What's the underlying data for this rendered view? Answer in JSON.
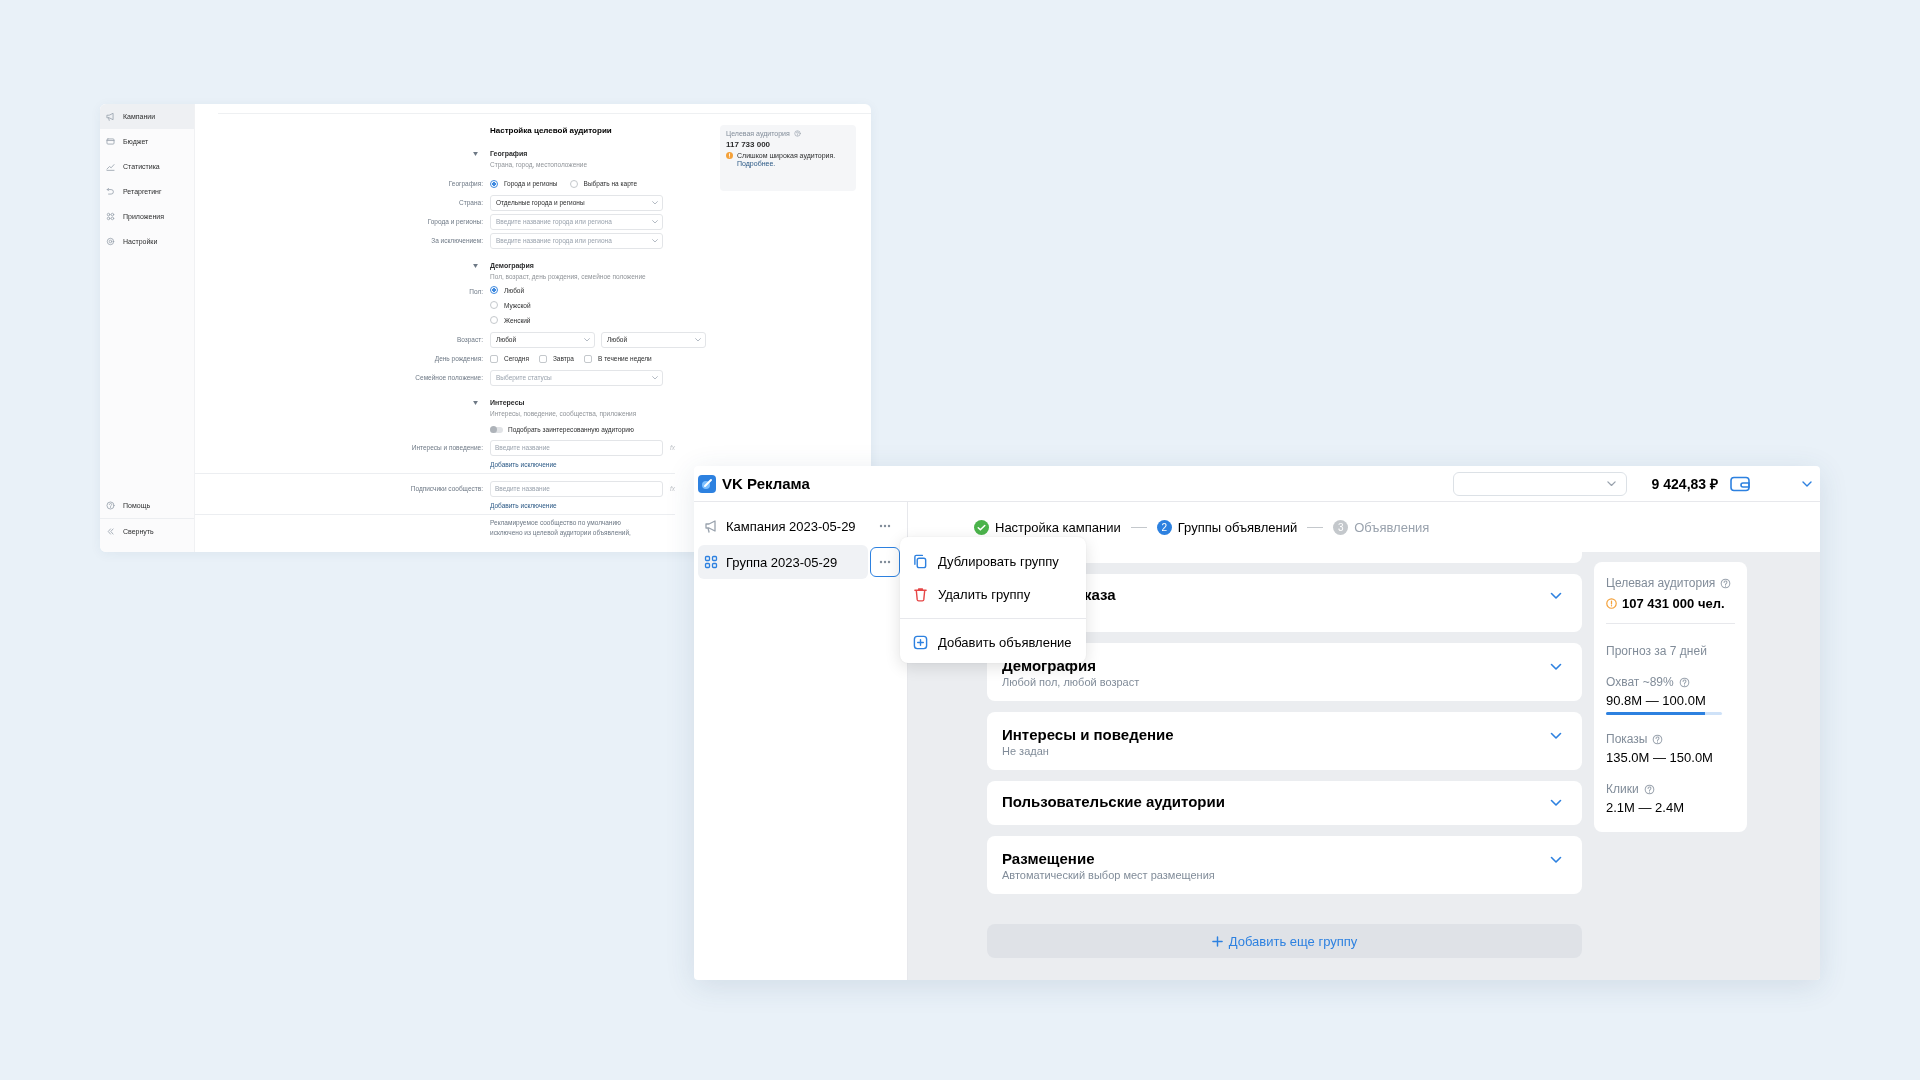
{
  "back_window": {
    "sidebar": {
      "items": [
        {
          "label": "Кампании",
          "selected": true
        },
        {
          "label": "Бюджет",
          "selected": false
        },
        {
          "label": "Статистика",
          "selected": false
        },
        {
          "label": "Ретаргетинг",
          "selected": false
        },
        {
          "label": "Приложения",
          "selected": false
        },
        {
          "label": "Настройки",
          "selected": false
        }
      ],
      "footer": [
        {
          "label": "Помощь"
        },
        {
          "label": "Свернуть"
        }
      ]
    },
    "form": {
      "title": "Настройка целевой аудитории",
      "sections": [
        {
          "title": "География",
          "subtitle": "Страна, город, местоположение",
          "rows": [
            {
              "kind": "radio-inline",
              "label": "География:",
              "options": [
                {
                  "label": "Города и регионы",
                  "selected": true
                },
                {
                  "label": "Выбрать на карте",
                  "selected": false
                }
              ]
            },
            {
              "kind": "select",
              "label": "Страна:",
              "value": "Отдельные города и регионы"
            },
            {
              "kind": "select",
              "label": "Города и регионы:",
              "placeholder": "Введите название города или региона"
            },
            {
              "kind": "select",
              "label": "За исключением:",
              "placeholder": "Введите название города или региона"
            }
          ]
        },
        {
          "title": "Демография",
          "subtitle": "Пол, возраст, день рождения, семейное положение",
          "rows": [
            {
              "kind": "radio-stack",
              "label": "Пол:",
              "options": [
                {
                  "label": "Любой",
                  "selected": true
                },
                {
                  "label": "Мужской",
                  "selected": false
                },
                {
                  "label": "Женский",
                  "selected": false
                }
              ]
            },
            {
              "kind": "select-pair",
              "label": "Возраст:",
              "values": [
                "Любой",
                "Любой"
              ]
            },
            {
              "kind": "checkboxes",
              "label": "День рождения:",
              "options": [
                {
                  "label": "Сегодня",
                  "checked": false
                },
                {
                  "label": "Завтра",
                  "checked": false
                },
                {
                  "label": "В течение недели",
                  "checked": false
                }
              ]
            },
            {
              "kind": "select",
              "label": "Семейное положение:",
              "placeholder": "Выберите статусы"
            }
          ]
        },
        {
          "title": "Интересы",
          "subtitle": "Интересы, поведение, сообщества, приложения",
          "rows": [
            {
              "kind": "toggle",
              "text": "Подобрать заинтересованную аудиторию",
              "on": false
            },
            {
              "kind": "input",
              "label": "Интересы и поведение:",
              "placeholder": "Введите название",
              "suffix": "fx",
              "link": "Добавить исключение"
            },
            {
              "kind": "input",
              "label": "Подписчики сообществ:",
              "placeholder": "Введите название",
              "suffix": "fx",
              "link": "Добавить исключение"
            },
            {
              "kind": "note",
              "text": "Рекламируемое сообщество по умолчанию исключено из целевой аудитории объявлений,"
            }
          ]
        }
      ]
    },
    "aside": {
      "label": "Целевая аудитория",
      "value": "117 733 000",
      "warning": "Слишком широкая аудитория.",
      "link": "Подробнее."
    }
  },
  "front_window": {
    "header": {
      "title": "VK Реклама",
      "balance": "9 424,83 ₽"
    },
    "tree": [
      {
        "label": "Кампания 2023-05-29",
        "kind": "campaign",
        "selected": false,
        "menu_open": false
      },
      {
        "label": "Группа 2023-05-29",
        "kind": "group",
        "selected": true,
        "menu_open": true
      }
    ],
    "menu": [
      {
        "label": "Дублировать группу",
        "kind": "copy",
        "divider_before": false
      },
      {
        "label": "Удалить группу",
        "kind": "delete",
        "divider_before": false
      },
      {
        "label": "Добавить объявление",
        "kind": "add",
        "divider_before": true
      }
    ],
    "steps": [
      {
        "label": "Настройка кампании",
        "completed": true,
        "selected": false
      },
      {
        "number": "2",
        "label": "Группы объявлений",
        "completed": false,
        "selected": true
      },
      {
        "number": "3",
        "label": "Объявления",
        "completed": false,
        "selected": false
      }
    ],
    "cards": [
      {
        "kind": "covered",
        "title": "каза"
      },
      {
        "kind": "section",
        "title": "Демография",
        "subtitle": "Любой пол, любой возраст"
      },
      {
        "kind": "section",
        "title": "Интересы и поведение",
        "subtitle": "Не задан"
      },
      {
        "kind": "section",
        "title": "Пользовательские аудитории"
      },
      {
        "kind": "section",
        "title": "Размещение",
        "subtitle": "Автоматический выбор мест размещения"
      }
    ],
    "add_button": "Добавить еще группу",
    "stats": {
      "audience_label": "Целевая аудитория",
      "audience_value": "107 431 000 чел.",
      "forecast_label": "Прогноз за 7 дней",
      "metrics": [
        {
          "label": "Охват ~89%",
          "value": "90.8M — 100.0M",
          "level": 0.85
        },
        {
          "label": "Показы",
          "value": "135.0M — 150.0M"
        },
        {
          "label": "Клики",
          "value": "2.1M — 2.4M"
        }
      ]
    }
  }
}
